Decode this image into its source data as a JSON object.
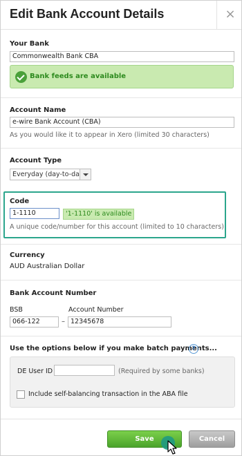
{
  "dialog": {
    "title": "Edit Bank Account Details",
    "close_glyph": "×"
  },
  "bank": {
    "label": "Your Bank",
    "value": "Commonwealth Bank CBA",
    "feeds_message": "Bank feeds are available"
  },
  "account_name": {
    "label": "Account Name",
    "value": "e-wire Bank Account (CBA)",
    "help": "As you would like it to appear in Xero (limited 30 characters)"
  },
  "account_type": {
    "label": "Account Type",
    "selected": "Everyday (day-to-day)"
  },
  "code": {
    "label": "Code",
    "value": "1-1110",
    "availability": "'1-1110' is available",
    "help": "A unique code/number for this account (limited to 10 characters)"
  },
  "currency": {
    "label": "Currency",
    "value": "AUD Australian Dollar"
  },
  "bank_account_number": {
    "label": "Bank Account Number",
    "bsb_label": "BSB",
    "bsb_value": "066-122",
    "separator": "–",
    "account_number_label": "Account Number",
    "account_number_value": "12345678"
  },
  "batch": {
    "heading": "Use the options below if you make batch payments...",
    "help_glyph": "?",
    "de_user_id_label": "DE User ID",
    "de_user_id_value": "",
    "de_user_id_note": "(Required by some banks)",
    "self_balancing_label": "Include self-balancing transaction in the ABA file",
    "self_balancing_checked": false
  },
  "footer": {
    "save_label": "Save",
    "cancel_label": "Cancel"
  },
  "colors": {
    "accent_green": "#4ba32b",
    "success_bg": "#c9eab0",
    "highlight_teal": "#2aa58c"
  }
}
